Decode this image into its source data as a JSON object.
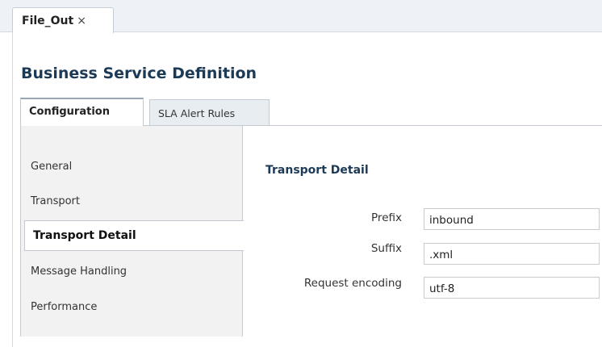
{
  "editor_tab": {
    "label": "File_Out",
    "close_glyph": "×"
  },
  "page_title": "Business Service Definition",
  "subtabs": [
    {
      "label": "Configuration",
      "active": true
    },
    {
      "label": "SLA Alert Rules",
      "active": false
    }
  ],
  "nav": {
    "items": [
      {
        "label": "General"
      },
      {
        "label": "Transport"
      },
      {
        "label": "Transport Detail",
        "selected": true
      },
      {
        "label": "Message Handling"
      },
      {
        "label": "Performance"
      }
    ]
  },
  "section_title": "Transport Detail",
  "fields": [
    {
      "label": "Prefix",
      "value": "inbound"
    },
    {
      "label": "Suffix",
      "value": ".xml"
    },
    {
      "label": "Request encoding",
      "value": "utf-8"
    }
  ],
  "colors": {
    "title": "#1c3a56",
    "tabstrip_bg": "#eef2f6",
    "nav_bg": "#f2f2f2",
    "inactive_tab_bg": "#e8edf2"
  }
}
